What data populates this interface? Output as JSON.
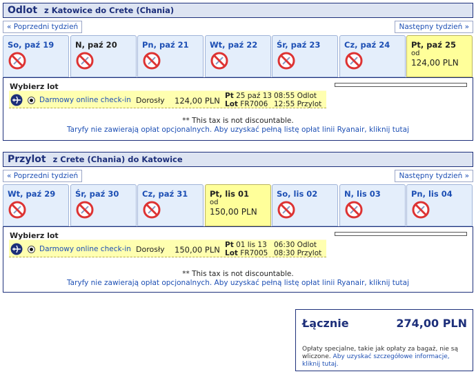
{
  "outbound": {
    "title": "Odlot",
    "route": "z Katowice do Crete (Chania)",
    "prev_week": "« Poprzedni tydzień",
    "next_week": "Następny tydzień »",
    "days": [
      {
        "label": "So, paź 19",
        "available": false
      },
      {
        "label": "N, paź 20",
        "available": false
      },
      {
        "label": "Pn, paź 21",
        "available": false
      },
      {
        "label": "Wt, paź 22",
        "available": false
      },
      {
        "label": "Śr, paź 23",
        "available": false
      },
      {
        "label": "Cz, paź 24",
        "available": false
      },
      {
        "label": "Pt, paź 25",
        "available": true,
        "from": "od",
        "price": "124,00 PLN"
      }
    ],
    "choose_label": "Wybierz lot",
    "checkin": "Darmowy online check-in",
    "passenger": "Dorosły",
    "fare": "124,00 PLN",
    "flight_day": "Pt",
    "flight_date": "25 paź 13",
    "flight_no_label": "Lot",
    "flight_no": "FR7006",
    "dep_time": "08:55 Odlot",
    "arr_time": "12:55 Przylot",
    "tax_note": "** This tax is not discountable.",
    "tariff_note": "Taryfy nie zawierają opłat opcjonalnych. Aby uzyskać pełną listę opłat linii Ryanair, kliknij tutaj"
  },
  "inbound": {
    "title": "Przylot",
    "route": "z Crete (Chania) do Katowice",
    "prev_week": "« Poprzedni tydzień",
    "next_week": "Następny tydzień »",
    "days": [
      {
        "label": "Wt, paź 29",
        "available": false
      },
      {
        "label": "Śr, paź 30",
        "available": false
      },
      {
        "label": "Cz, paź 31",
        "available": false
      },
      {
        "label": "Pt, lis 01",
        "available": true,
        "from": "od",
        "price": "150,00 PLN"
      },
      {
        "label": "So, lis 02",
        "available": false
      },
      {
        "label": "N, lis 03",
        "available": false
      },
      {
        "label": "Pn, lis 04",
        "available": false
      }
    ],
    "choose_label": "Wybierz lot",
    "checkin": "Darmowy online check-in",
    "passenger": "Dorosły",
    "fare": "150,00 PLN",
    "flight_day": "Pt",
    "flight_date": "01 lis 13",
    "flight_no_label": "Lot",
    "flight_no": "FR7005",
    "dep_time": "06:30 Odlot",
    "arr_time": "08:30 Przylot",
    "tax_note": "** This tax is not discountable.",
    "tariff_note": "Taryfy nie zawierają opłat opcjonalnych. Aby uzyskać pełną listę opłat linii Ryanair, kliknij tutaj"
  },
  "total": {
    "label": "Łącznie",
    "value": "274,00 PLN",
    "note": "Opłaty specjalne, takie jak opłaty za bagaż, nie są wliczone.",
    "note_link": "Aby uzyskać szczegółowe informacje, kliknij tutaj."
  }
}
